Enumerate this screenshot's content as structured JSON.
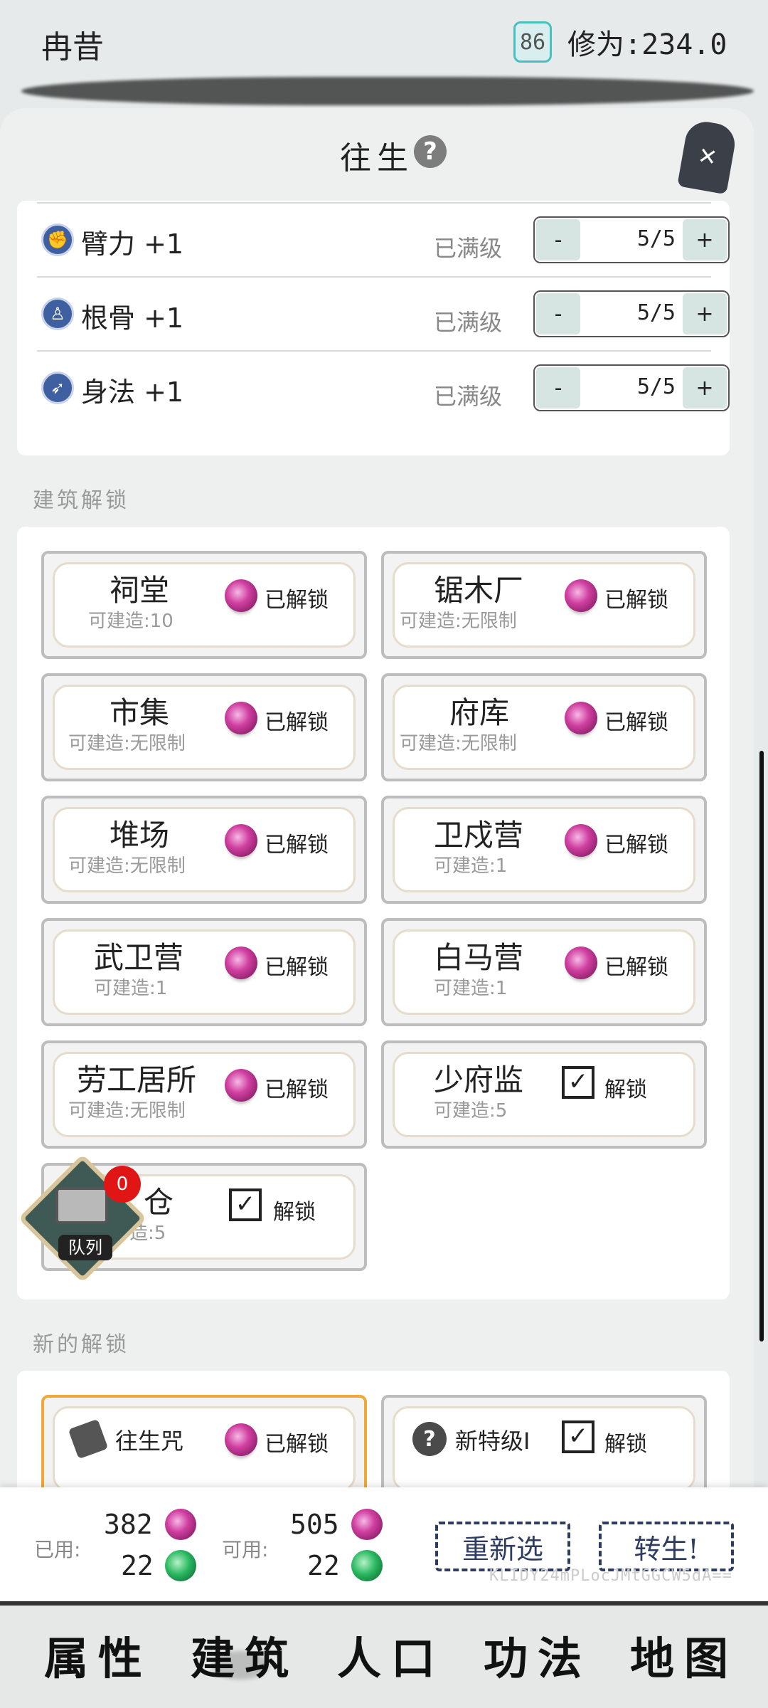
{
  "header": {
    "player_name": "冉昔",
    "level": "86",
    "cultivation": "修为:234.0"
  },
  "panel": {
    "title": "往生",
    "help_icon": "?",
    "close_icon": "✕"
  },
  "stats": [
    {
      "label": "臂力 +1",
      "status": "已满级",
      "minus": "-",
      "value": "5/5",
      "plus": "+"
    },
    {
      "label": "根骨 +1",
      "status": "已满级",
      "minus": "-",
      "value": "5/5",
      "plus": "+"
    },
    {
      "label": "身法 +1",
      "status": "已满级",
      "minus": "-",
      "value": "5/5",
      "plus": "+"
    }
  ],
  "sections": {
    "buildings": "建筑解锁",
    "new_unlocks": "新的解锁"
  },
  "buildings": [
    {
      "name": "祠堂",
      "sub": "可建造:10",
      "state": "已解锁",
      "unlocked": true
    },
    {
      "name": "锯木厂",
      "sub": "可建造:无限制",
      "state": "已解锁",
      "unlocked": true
    },
    {
      "name": "市集",
      "sub": "可建造:无限制",
      "state": "已解锁",
      "unlocked": true
    },
    {
      "name": "府库",
      "sub": "可建造:无限制",
      "state": "已解锁",
      "unlocked": true
    },
    {
      "name": "堆场",
      "sub": "可建造:无限制",
      "state": "已解锁",
      "unlocked": true
    },
    {
      "name": "卫戍营",
      "sub": "可建造:1",
      "state": "已解锁",
      "unlocked": true
    },
    {
      "name": "武卫营",
      "sub": "可建造:1",
      "state": "已解锁",
      "unlocked": true
    },
    {
      "name": "白马营",
      "sub": "可建造:1",
      "state": "已解锁",
      "unlocked": true
    },
    {
      "name": "劳工居所",
      "sub": "可建造:无限制",
      "state": "已解锁",
      "unlocked": true
    },
    {
      "name": "少府监",
      "sub": "可建造:5",
      "state": "解锁",
      "unlocked": false
    },
    {
      "name": "仓",
      "sub": "造:5",
      "state": "解锁",
      "unlocked": false
    }
  ],
  "queue": {
    "label": "队列",
    "count": "0"
  },
  "new_unlocks": [
    {
      "name": "往生咒",
      "state": "已解锁",
      "icon": "book-icon"
    },
    {
      "name": "新特级I",
      "state": "解锁",
      "icon": "question-icon"
    }
  ],
  "summary": {
    "used_label": "已用:",
    "used_purple": "382",
    "used_green": "22",
    "avail_label": "可用:",
    "avail_purple": "505",
    "avail_green": "22",
    "reselect": "重新选",
    "reincarnate": "转生!",
    "hash": "KLIDY24mPLocJMtGGCW5dA=="
  },
  "nav": [
    "属性",
    "建筑",
    "人口",
    "功法",
    "地图"
  ],
  "colors": {
    "accent_teal": "#49c0c0",
    "selected_border": "#f0a838",
    "badge_red": "#e01616",
    "button_ink": "#2d3c60"
  }
}
